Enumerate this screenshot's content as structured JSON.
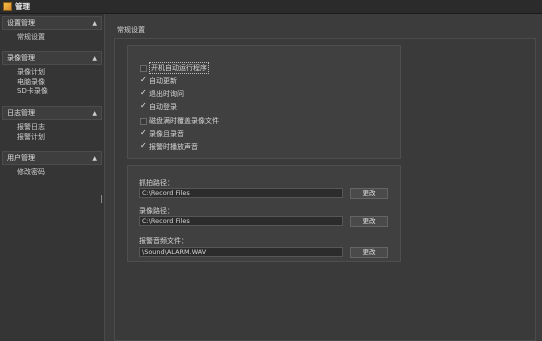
{
  "window": {
    "title": "管理"
  },
  "sidebar": {
    "groups": [
      {
        "label": "设置管理",
        "items": [
          "常规设置"
        ]
      },
      {
        "label": "录像管理",
        "items": [
          "录像计划",
          "电脑录像",
          "SD卡录像"
        ]
      },
      {
        "label": "日志管理",
        "items": [
          "报警日志",
          "报警计划"
        ]
      },
      {
        "label": "用户管理",
        "items": [
          "修改密码"
        ]
      }
    ]
  },
  "main": {
    "section_title": "常规设置",
    "options": [
      {
        "label": "开机自动运行程序",
        "checked": false,
        "focused": true
      },
      {
        "label": "自动更新",
        "checked": true
      },
      {
        "label": "退出时询问",
        "checked": true
      },
      {
        "label": "自动登录",
        "checked": true
      },
      {
        "label": "磁盘满时覆盖录像文件",
        "checked": false
      },
      {
        "label": "录像且录音",
        "checked": true
      },
      {
        "label": "报警时播放声音",
        "checked": true
      }
    ],
    "paths": [
      {
        "label": "抓拍路径：",
        "value": "C:\\Record Files",
        "button": "更改"
      },
      {
        "label": "录像路径：",
        "value": "C:\\Record Files",
        "button": "更改"
      },
      {
        "label": "报警音频文件：",
        "value": "\\Sound\\ALARM.WAV",
        "button": "更改"
      }
    ]
  }
}
